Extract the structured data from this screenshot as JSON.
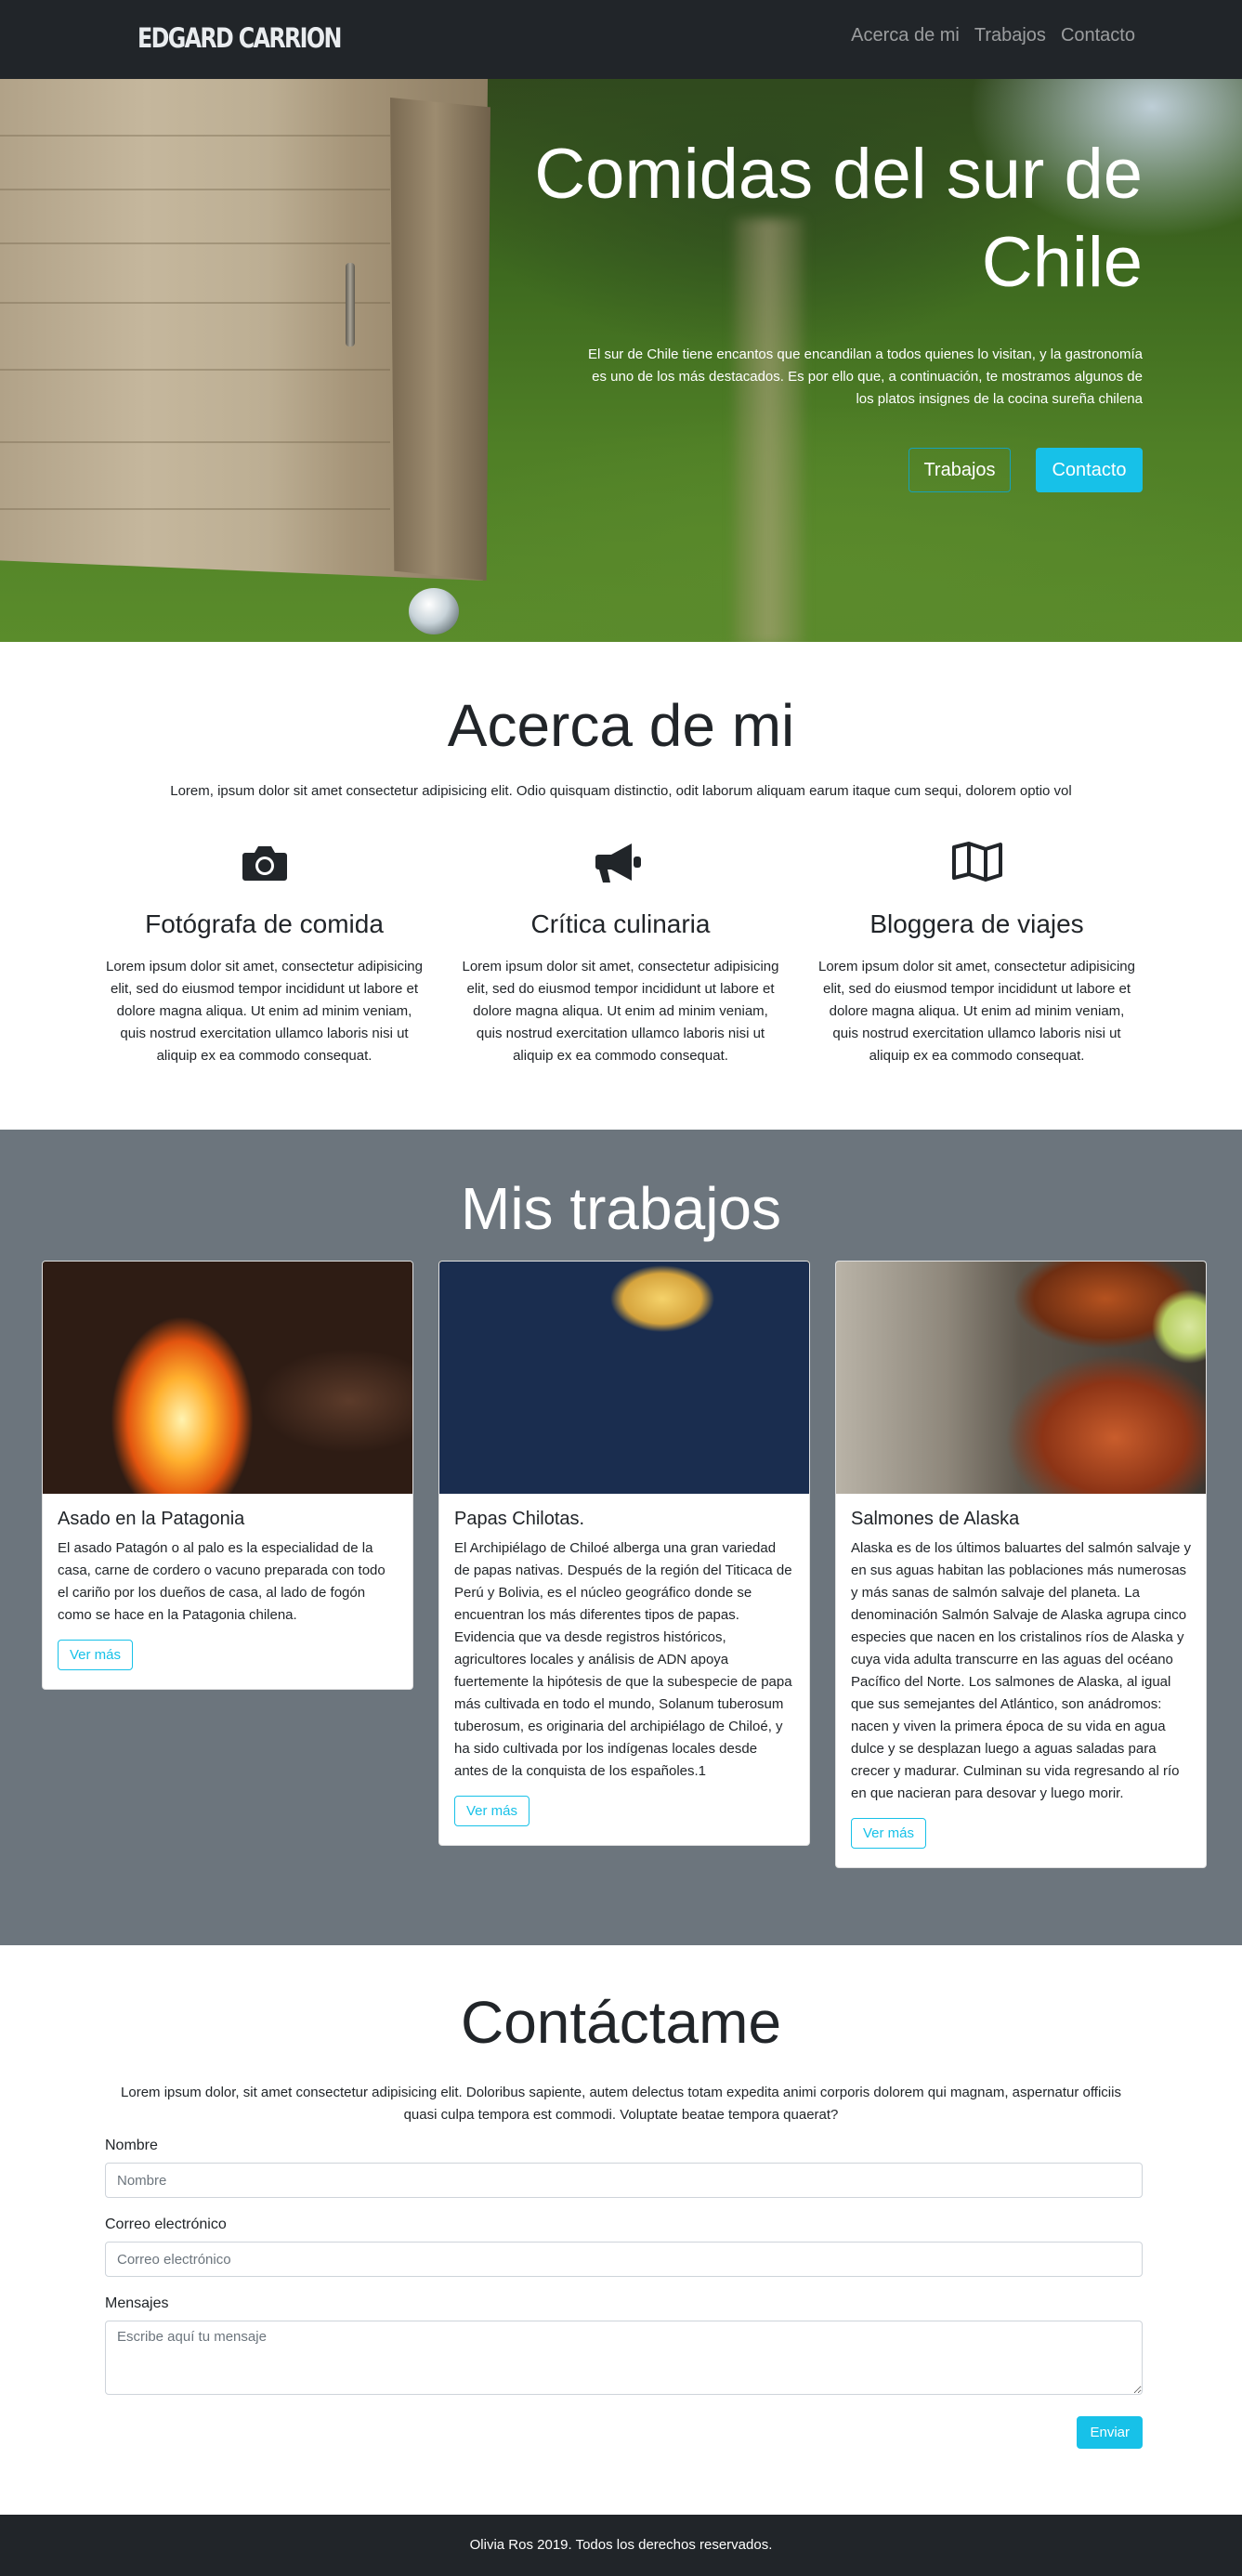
{
  "navbar": {
    "brand": "EDGARD CARRION",
    "links": [
      "Acerca de mi",
      "Trabajos",
      "Contacto"
    ]
  },
  "hero": {
    "title": "Comidas del sur de Chile",
    "text": "El sur de Chile tiene encantos que encandilan a todos quienes lo visitan, y la gastronomía es uno de los más destacados. Es por ello que, a continuación, te mostramos algunos de los platos insignes de la cocina sureña chilena",
    "button_outline": "Trabajos",
    "button_primary": "Contacto"
  },
  "about": {
    "title": "Acerca de mi",
    "intro": "Lorem, ipsum dolor sit amet consectetur adipisicing elit. Odio quisquam distinctio, odit laborum aliquam earum itaque cum sequi, dolorem optio vol",
    "features": [
      {
        "icon": "camera-icon",
        "title": "Fotógrafa de comida",
        "text": "Lorem ipsum dolor sit amet, consectetur adipisicing elit, sed do eiusmod tempor incididunt ut labore et dolore magna aliqua. Ut enim ad minim veniam, quis nostrud exercitation ullamco laboris nisi ut aliquip ex ea commodo consequat."
      },
      {
        "icon": "megaphone-icon",
        "title": "Crítica culinaria",
        "text": "Lorem ipsum dolor sit amet, consectetur adipisicing elit, sed do eiusmod tempor incididunt ut labore et dolore magna aliqua. Ut enim ad minim veniam, quis nostrud exercitation ullamco laboris nisi ut aliquip ex ea commodo consequat."
      },
      {
        "icon": "map-icon",
        "title": "Bloggera de viajes",
        "text": "Lorem ipsum dolor sit amet, consectetur adipisicing elit, sed do eiusmod tempor incididunt ut labore et dolore magna aliqua. Ut enim ad minim veniam, quis nostrud exercitation ullamco laboris nisi ut aliquip ex ea commodo consequat."
      }
    ]
  },
  "works": {
    "title": "Mis trabajos",
    "cards": [
      {
        "title": "Asado en la Patagonia",
        "text": "El asado Patagón o al palo es la especialidad de la casa, carne de cordero o vacuno preparada con todo el cariño por los dueños de casa, al lado de fogón como se hace en la Patagonia chilena.",
        "button": "Ver más"
      },
      {
        "title": "Papas Chilotas.",
        "text": "El Archipiélago de Chiloé alberga una gran variedad de papas nativas. Después de la región del Titicaca de Perú y Bolivia, es el núcleo geográfico donde se encuentran los más diferentes tipos de papas. Evidencia que va desde registros históricos, agricultores locales y análisis de ADN apoya fuertemente la hipótesis de que la subespecie de papa más cultivada en todo el mundo, Solanum tuberosum tuberosum, es originaria del archipiélago de Chiloé, y ha sido cultivada por los indígenas locales desde antes de la conquista de los españoles.1",
        "button": "Ver más"
      },
      {
        "title": "Salmones de Alaska",
        "text": "Alaska es de los últimos baluartes del salmón salvaje y en sus aguas habitan las poblaciones más numerosas y más sanas de salmón salvaje del planeta. La denominación Salmón Salvaje de Alaska agrupa cinco especies que nacen en los cristalinos ríos de Alaska y cuya vida adulta transcurre en las aguas del océano Pacífico del Norte. Los salmones de Alaska, al igual que sus semejantes del Atlántico, son anádromos: nacen y viven la primera época de su vida en agua dulce y se desplazan luego a aguas saladas para crecer y madurar. Culminan su vida regresando al río en que nacieran para desovar y luego morir.",
        "button": "Ver más"
      }
    ]
  },
  "contact": {
    "title": "Contáctame",
    "intro": "Lorem ipsum dolor, sit amet consectetur adipisicing elit. Doloribus sapiente, autem delectus totam expedita animi corporis dolorem qui magnam, aspernatur officiis quasi culpa tempora est commodi. Voluptate beatae tempora quaerat?",
    "name_label": "Nombre",
    "name_placeholder": "Nombre",
    "email_label": "Correo electrónico",
    "email_placeholder": "Correo electrónico",
    "message_label": "Mensajes",
    "message_placeholder": "Escribe aquí tu mensaje",
    "submit": "Enviar"
  },
  "footer": {
    "text": "Olivia Ros 2019. Todos los derechos reservados."
  },
  "colors": {
    "dark": "#212529",
    "gray": "#6c757d",
    "accent": "#17c1e8"
  }
}
